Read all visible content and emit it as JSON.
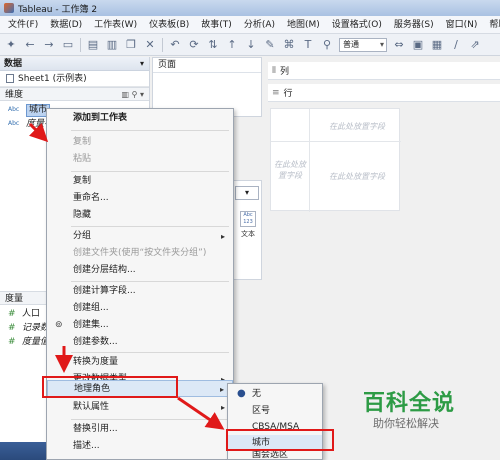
{
  "window": {
    "title": "Tableau - 工作簿 2"
  },
  "menubar": [
    "文件(F)",
    "数据(D)",
    "工作表(W)",
    "仪表板(B)",
    "故事(T)",
    "分析(A)",
    "地图(M)",
    "设置格式(O)",
    "服务器(S)",
    "窗口(N)",
    "帮助(H)"
  ],
  "toolbar": {
    "format_value": "普通"
  },
  "data_pane": {
    "header": "数据",
    "datasource": "Sheet1 (示例表)",
    "dimensions_label": "维度",
    "dimensions": [
      {
        "type": "Abc",
        "name": "城市",
        "selected": true
      },
      {
        "type": "Abc",
        "name": "度量名称",
        "italic": true
      }
    ],
    "measures_label": "度量",
    "measures": [
      {
        "type": "#",
        "name": "人口"
      },
      {
        "type": "#",
        "name": "记录数",
        "italic": true
      },
      {
        "type": "#",
        "name": "度量值",
        "italic": true
      }
    ]
  },
  "shelves": {
    "pages": "页面",
    "columns": "列",
    "rows": "行"
  },
  "marks": {
    "text_tile_top": "Abc",
    "text_tile_bottom": "123",
    "text_tile_label": "文本"
  },
  "view_hints": {
    "field_top": "在此处放置字段",
    "field_left": "在此处放置字段",
    "field_body": "在此处放置字段"
  },
  "context_menu": [
    {
      "label": "添加到工作表",
      "bold": true
    },
    {
      "label": "复制",
      "disabled": true
    },
    {
      "label": "粘贴",
      "disabled": true
    },
    {
      "label": "复制"
    },
    {
      "label": "重命名..."
    },
    {
      "label": "隐藏"
    },
    {
      "label": "分组",
      "submenu": true
    },
    {
      "label": "创建文件夹(使用“按文件夹分组”)",
      "disabled": true
    },
    {
      "label": "创建分层结构..."
    },
    {
      "label": "创建计算字段..."
    },
    {
      "label": "创建组..."
    },
    {
      "label": "创建集..."
    },
    {
      "label": "创建参数..."
    },
    {
      "label": "转换为度量"
    },
    {
      "label": "更改数据类型",
      "submenu": true
    },
    {
      "label": "地理角色",
      "submenu": true,
      "active": true
    },
    {
      "label": "默认属性",
      "submenu": true
    },
    {
      "label": "替换引用..."
    },
    {
      "label": "描述..."
    }
  ],
  "geo_submenu": [
    {
      "label": "无",
      "checked": true
    },
    {
      "label": "区号"
    },
    {
      "label": "CBSA/MSA"
    },
    {
      "label": "城市",
      "highlight": true
    },
    {
      "label": "国会选区"
    }
  ],
  "watermark": {
    "title": "百科全说",
    "subtitle": "助你轻松解决"
  },
  "colors": {
    "annotation": "#e01919",
    "watermark": "#2d9b45",
    "selection": "#bcd3f0"
  }
}
